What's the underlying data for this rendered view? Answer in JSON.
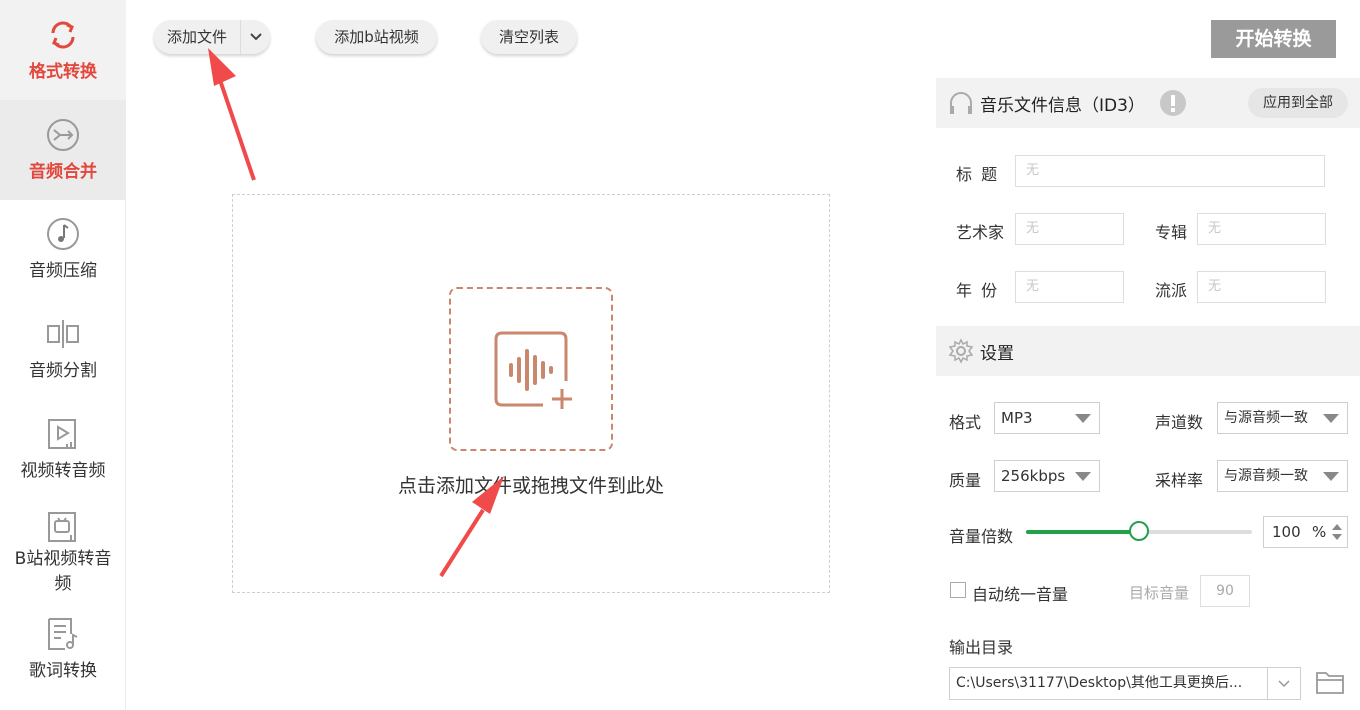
{
  "sidebar": {
    "items": [
      {
        "label": "格式转换",
        "icon": "refresh-icon"
      },
      {
        "label": "音频合并",
        "icon": "merge-icon"
      },
      {
        "label": "音频压缩",
        "icon": "music-note-icon"
      },
      {
        "label": "音频分割",
        "icon": "split-icon"
      },
      {
        "label": "视频转音频",
        "icon": "video-audio-icon"
      },
      {
        "label_line1": "B站视频转音",
        "label_line2": "频",
        "icon": "bilibili-tv-icon"
      },
      {
        "label": "歌词转换",
        "icon": "lyrics-icon"
      }
    ]
  },
  "toolbar": {
    "add_file": "添加文件",
    "add_bilibili": "添加b站视频",
    "clear_list": "清空列表",
    "start": "开始转换"
  },
  "dropzone": {
    "hint": "点击添加文件或拖拽文件到此处"
  },
  "id3": {
    "title": "音乐文件信息（ID3）",
    "apply_all": "应用到全部",
    "fields": {
      "title_label": "标  题",
      "artist_label": "艺术家",
      "album_label": "专辑",
      "year_label": "年  份",
      "genre_label": "流派",
      "placeholder": "无"
    }
  },
  "settings": {
    "title": "设置",
    "format_label": "格式",
    "format_value": "MP3",
    "channels_label": "声道数",
    "channels_value": "与源音频一致",
    "quality_label": "质量",
    "quality_value": "256kbps",
    "samplerate_label": "采样率",
    "samplerate_value": "与源音频一致",
    "volume_label": "音量倍数",
    "volume_value": "100",
    "volume_unit": "%",
    "volume_fraction": 0.5,
    "auto_volume_label": "自动统一音量",
    "target_volume_label": "目标音量",
    "target_volume_value": "90",
    "output_label": "输出目录",
    "output_path": "C:\\Users\\31177\\Desktop\\其他工具更换后..."
  },
  "colors": {
    "accent_red": "#e2483d",
    "slider_green": "#22a04a",
    "drop_icon": "#c9876d",
    "arrow_red": "#f04a4a"
  }
}
